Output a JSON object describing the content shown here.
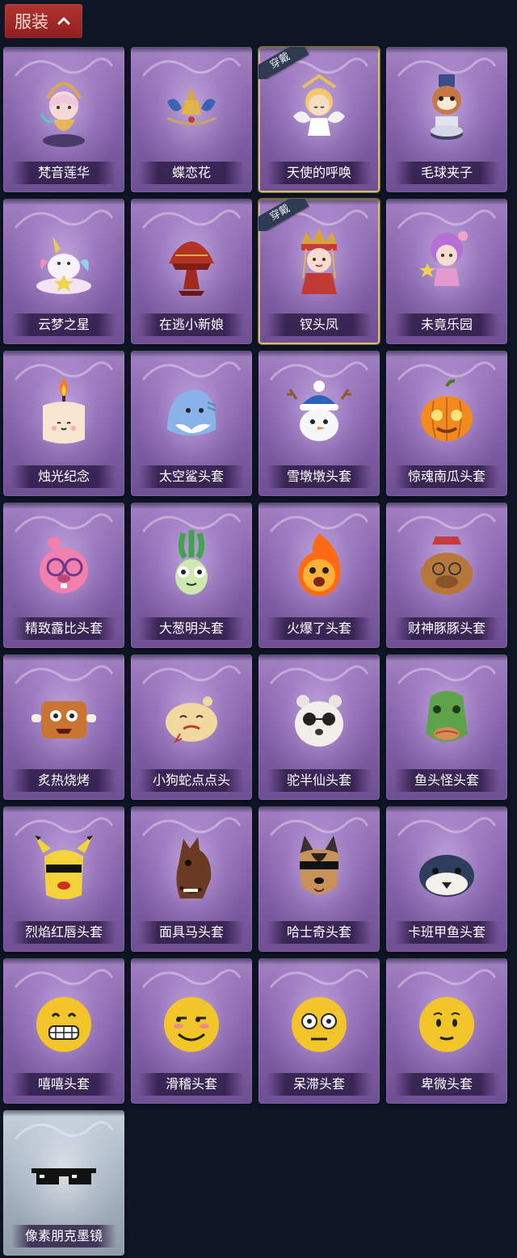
{
  "header": {
    "title": "服装",
    "toggle_icon": "chevron-up-icon"
  },
  "badge_text": "穿戴",
  "items": [
    {
      "name": "梵音莲华",
      "icon": "ornate-girl-figure-icon",
      "equipped": false,
      "style": "purple"
    },
    {
      "name": "蝶恋花",
      "icon": "butterfly-bell-headdress-icon",
      "equipped": false,
      "style": "purple"
    },
    {
      "name": "天使的呼唤",
      "icon": "angel-figure-icon",
      "equipped": true,
      "style": "purple"
    },
    {
      "name": "毛球夹子",
      "icon": "raccoon-drummer-icon",
      "equipped": false,
      "style": "purple"
    },
    {
      "name": "云梦之星",
      "icon": "unicorn-cloud-icon",
      "equipped": false,
      "style": "purple"
    },
    {
      "name": "在逃小新娘",
      "icon": "red-bridal-veil-icon",
      "equipped": false,
      "style": "purple"
    },
    {
      "name": "钗头凤",
      "icon": "phoenix-crown-figure-icon",
      "equipped": true,
      "style": "purple"
    },
    {
      "name": "未竟乐园",
      "icon": "candy-girl-figure-icon",
      "equipped": false,
      "style": "purple"
    },
    {
      "name": "烛光纪念",
      "icon": "candle-head-icon",
      "equipped": false,
      "style": "purple"
    },
    {
      "name": "太空鲨头套",
      "icon": "shark-mask-icon",
      "equipped": false,
      "style": "purple"
    },
    {
      "name": "雪墩墩头套",
      "icon": "snowman-mask-icon",
      "equipped": false,
      "style": "purple"
    },
    {
      "name": "惊魂南瓜头套",
      "icon": "pumpkin-mask-icon",
      "equipped": false,
      "style": "purple"
    },
    {
      "name": "精致露比头套",
      "icon": "pink-beaver-mask-icon",
      "equipped": false,
      "style": "purple"
    },
    {
      "name": "大葱明头套",
      "icon": "green-onion-mask-icon",
      "equipped": false,
      "style": "purple"
    },
    {
      "name": "火爆了头套",
      "icon": "fire-mask-icon",
      "equipped": false,
      "style": "purple"
    },
    {
      "name": "财神豚豚头套",
      "icon": "capybara-mask-icon",
      "equipped": false,
      "style": "purple"
    },
    {
      "name": "炙热烧烤",
      "icon": "bbq-meat-mask-icon",
      "equipped": false,
      "style": "purple"
    },
    {
      "name": "小狗蛇点点头",
      "icon": "snake-mask-icon",
      "equipped": false,
      "style": "purple"
    },
    {
      "name": "驼半仙头套",
      "icon": "bear-sunglasses-mask-icon",
      "equipped": false,
      "style": "purple"
    },
    {
      "name": "鱼头怪头套",
      "icon": "fish-head-mask-icon",
      "equipped": false,
      "style": "purple"
    },
    {
      "name": "烈焰红唇头套",
      "icon": "pikachu-mask-icon",
      "equipped": false,
      "style": "purple"
    },
    {
      "name": "面具马头套",
      "icon": "horse-mask-icon",
      "equipped": false,
      "style": "purple"
    },
    {
      "name": "哈士奇头套",
      "icon": "husky-mask-icon",
      "equipped": false,
      "style": "purple"
    },
    {
      "name": "卡班甲鱼头套",
      "icon": "round-fish-mask-icon",
      "equipped": false,
      "style": "purple"
    },
    {
      "name": "嘻嘻头套",
      "icon": "grin-emoji-mask-icon",
      "equipped": false,
      "style": "purple"
    },
    {
      "name": "滑稽头套",
      "icon": "smirk-emoji-mask-icon",
      "equipped": false,
      "style": "purple"
    },
    {
      "name": "呆滞头套",
      "icon": "dazed-emoji-mask-icon",
      "equipped": false,
      "style": "purple"
    },
    {
      "name": "卑微头套",
      "icon": "shy-emoji-mask-icon",
      "equipped": false,
      "style": "purple"
    },
    {
      "name": "像素朋克墨镜",
      "icon": "pixel-sunglasses-icon",
      "equipped": false,
      "style": "grey"
    }
  ],
  "colors": {
    "background": "#0e1524",
    "header_red": "#a62a28",
    "card_purple": "#8a66ae",
    "card_grey": "#aab6c4",
    "equipped_gold": "#d8bd76"
  }
}
